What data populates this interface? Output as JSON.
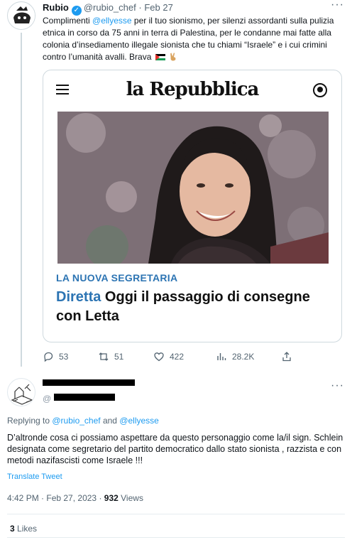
{
  "tweet1": {
    "name": "Rubio",
    "handle": "@rubio_chef",
    "separator": "·",
    "date": "Feb 27",
    "text_1": "Complimenti ",
    "mention": "@ellyesse",
    "text_2": " per il tuo sionismo, per silenzi assordanti sulla pulizia etnica in corso da 75 anni in terra di Palestina, per le condanne mai fatte alla colonia d’insediamento illegale sionista che tu chiami “Israele” e i cui crimini contro l’umanità avalli. Brava",
    "card": {
      "masthead": "la Repubblica",
      "kicker": "LA NUOVA SEGRETARIA",
      "live_label": "Diretta",
      "headline": " Oggi il passaggio di consegne con Letta"
    },
    "stats": {
      "replies": "53",
      "retweets": "51",
      "likes": "422",
      "views": "28.2K"
    }
  },
  "tweet2": {
    "handle": "@",
    "replying_prefix": "Replying to ",
    "replying_to_1": "@rubio_chef",
    "replying_and": " and ",
    "replying_to_2": "@ellyesse",
    "text": "D’altronde cosa ci possiamo aspettare da questo personaggio come la/il sign. Schlein designata come segretario del partito democratico dallo stato sionista , razzista e con metodi nazifascisti come Israele !!!",
    "translate_label": "Translate Tweet",
    "time": "4:42 PM",
    "separator": " · ",
    "date": "Feb 27, 2023",
    "views_count": "932",
    "views_label": " Views",
    "likes_count": "3",
    "likes_label": " Likes"
  },
  "colors": {
    "accent": "#1d9bf0",
    "text": "#0f1419",
    "muted": "#536471",
    "repubblica_blue": "#2c74b3"
  }
}
